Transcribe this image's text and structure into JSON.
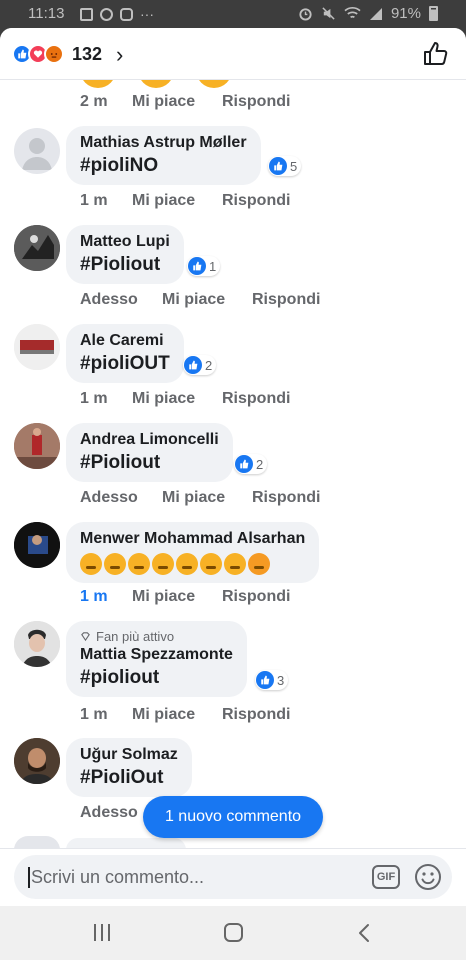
{
  "status_bar": {
    "time": "11:13",
    "dots": "···",
    "battery": "91%"
  },
  "header": {
    "reaction_count": "132",
    "reactions": [
      "like",
      "love",
      "angry"
    ],
    "chevron": "›"
  },
  "comments": [
    {
      "name": "Mathias Astrup Møller",
      "text": "#pioliNO",
      "likes": "5",
      "time": "1 m",
      "like_label": "Mi piace",
      "reply_label": "Rispondi"
    },
    {
      "name": "Matteo Lupi",
      "text": "#Pioliout",
      "likes": "1",
      "time": "Adesso",
      "like_label": "Mi piace",
      "reply_label": "Rispondi"
    },
    {
      "name": "Ale Caremi",
      "text": "#pioliOUT",
      "likes": "2",
      "time": "1 m",
      "like_label": "Mi piace",
      "reply_label": "Rispondi"
    },
    {
      "name": "Andrea Limoncelli",
      "text": "#Pioliout",
      "likes": "2",
      "time": "Adesso",
      "like_label": "Mi piace",
      "reply_label": "Rispondi"
    },
    {
      "name": "Menwer Mohammad Alsarhan",
      "text": "",
      "emoji": [
        "sad-pensive",
        "sad-pensive",
        "sad-pensive",
        "sad-pensive",
        "sad-pensive",
        "sad-pensive",
        "sad-pensive",
        "angry-face"
      ],
      "time": "1 m",
      "like_label": "Mi piace",
      "reply_label": "Rispondi"
    },
    {
      "badge": "Fan più attivo",
      "name": "Mattia Spezzamonte",
      "text": "#pioliout",
      "likes": "3",
      "time": "1 m",
      "like_label": "Mi piace",
      "reply_label": "Rispondi"
    },
    {
      "name": "Uğur Solmaz",
      "text": "#PioliOut",
      "time": "Adesso"
    }
  ],
  "top_partial": {
    "time": "2 m",
    "like_label": "Mi piace",
    "reply_label": "Rispondi"
  },
  "new_comment_pill": "1 nuovo commento",
  "composer": {
    "placeholder": "Scrivi un commento...",
    "gif_label": "GIF"
  },
  "colors": {
    "accent": "#1877f2",
    "bubble": "#f0f2f5",
    "muted": "#65676b"
  }
}
